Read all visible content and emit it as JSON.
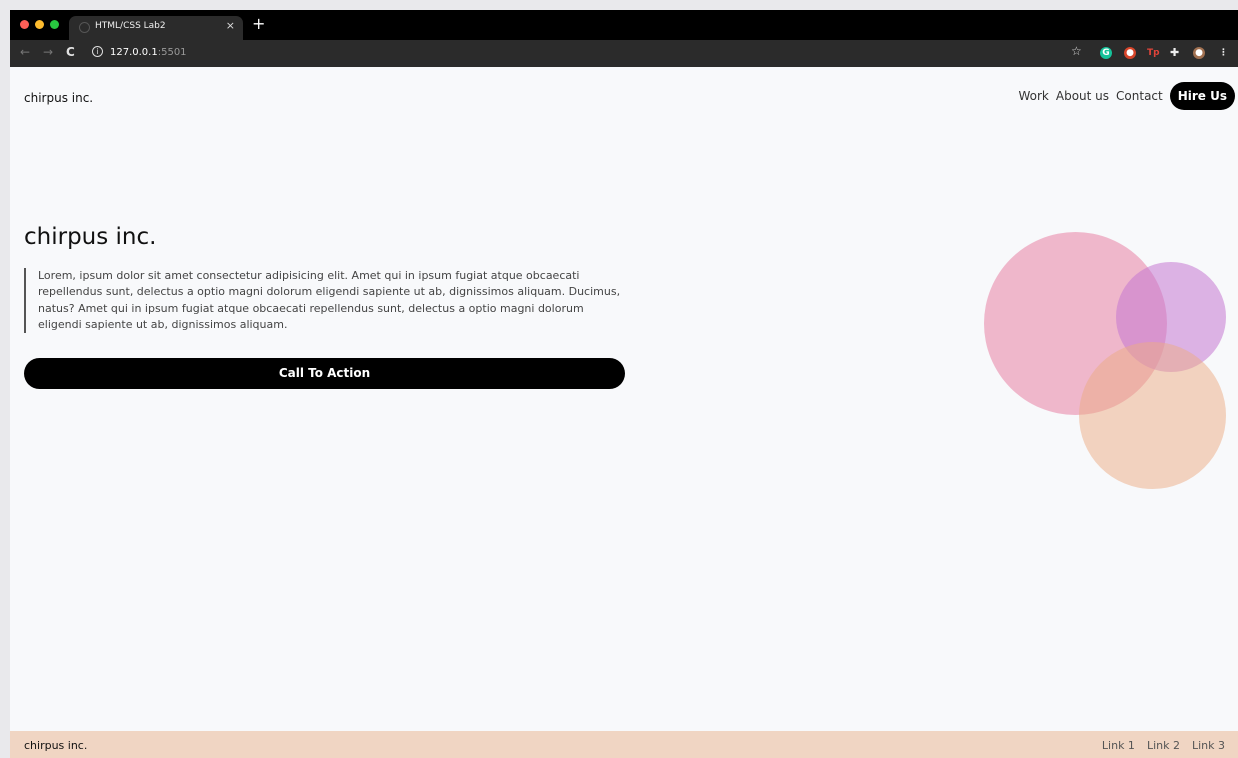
{
  "browser": {
    "tab_title": "HTML/CSS Lab2",
    "tab_close": "×",
    "new_tab": "+",
    "url_host": "127.0.0.1",
    "url_port": ":5501"
  },
  "header": {
    "brand": "chirpus inc.",
    "nav": [
      "Work",
      "About us",
      "Contact"
    ],
    "hire_label": "Hire Us"
  },
  "hero": {
    "title": "chirpus inc.",
    "body": "Lorem, ipsum dolor sit amet consectetur adipisicing elit. Amet qui in ipsum fugiat atque obcaecati repellendus sunt, delectus a optio magni dolorum eligendi sapiente ut ab, dignissimos aliquam. Ducimus, natus? Amet qui in ipsum fugiat atque obcaecati repellendus sunt, delectus a optio magni dolorum eligendi sapiente ut ab, dignissimos aliquam.",
    "cta_label": "Call To Action"
  },
  "footer": {
    "brand": "chirpus inc.",
    "links": [
      "Link 1",
      "Link 2",
      "Link 3"
    ]
  },
  "colors": {
    "accent": "#000000",
    "footer_bg": "#f0d5c3",
    "circle_pink": "#e882a4",
    "circle_purple": "#c478d2",
    "circle_peach": "#ecac84"
  }
}
